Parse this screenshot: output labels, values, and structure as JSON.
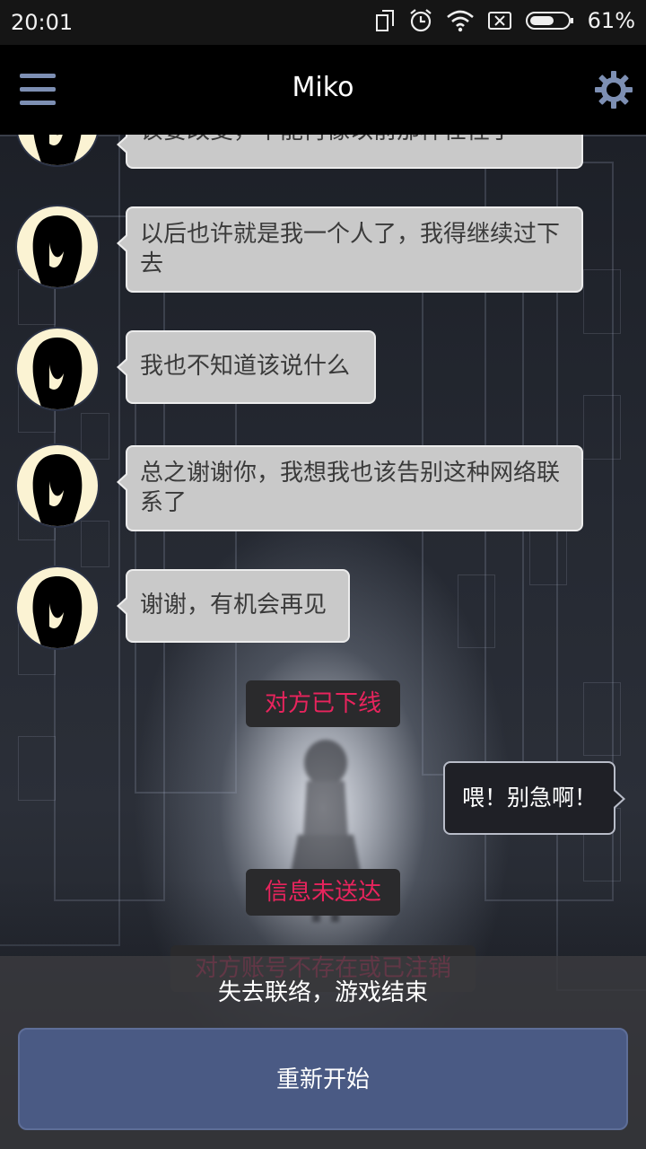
{
  "status_bar": {
    "time": "20:01",
    "battery_percent": "61%",
    "icons": [
      "screen-rotate-icon",
      "alarm-icon",
      "wifi-icon",
      "no-sim-icon",
      "battery-icon"
    ]
  },
  "app_bar": {
    "title": "Miko",
    "menu_icon": "hamburger-menu-icon",
    "settings_icon": "gear-icon"
  },
  "chat": {
    "partner_messages": [
      {
        "text": "该要改变，不能再像以前那样任性了"
      },
      {
        "text": "以后也许就是我一个人了，我得继续过下去"
      },
      {
        "text": "我也不知道该说什么"
      },
      {
        "text": "总之谢谢你，我想我也该告别这种网络联系了"
      },
      {
        "text": "谢谢，有机会再见"
      }
    ],
    "system_notices": {
      "offline": "对方已下线",
      "not_delivered": "信息未送达",
      "account_missing": "对方账号不存在或已注销"
    },
    "my_reply": "喂！别急啊！"
  },
  "game_over": {
    "message": "失去联络，游戏结束",
    "restart_label": "重新开始"
  },
  "colors": {
    "accent_blue": "#4a5a84",
    "notice_red": "#e8245d",
    "bubble_gray": "#c9c9c9"
  }
}
